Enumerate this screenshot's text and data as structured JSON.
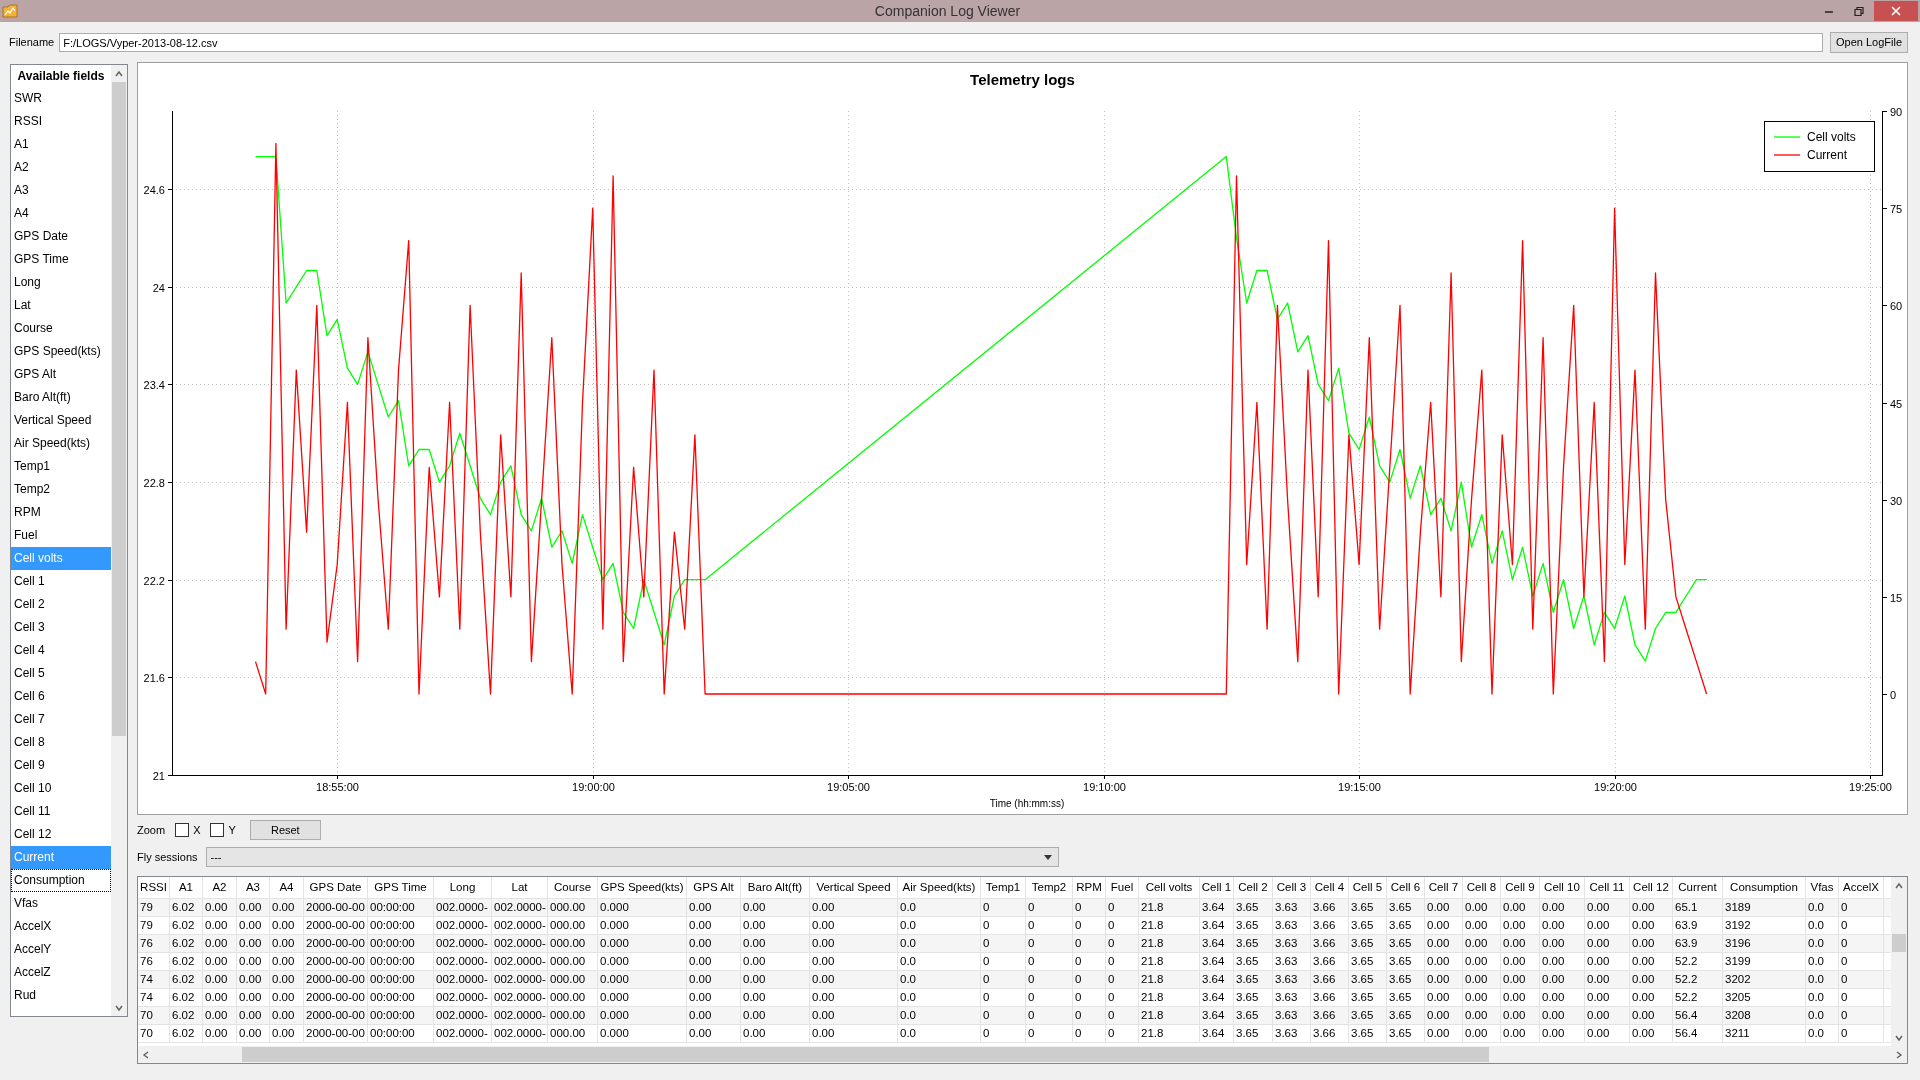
{
  "window": {
    "title": "Companion Log Viewer"
  },
  "filename": {
    "label": "Filename",
    "value": "F:/LOGS/Vyper-2013-08-12.csv",
    "button": "Open LogFile"
  },
  "fields": {
    "header": "Available fields",
    "items": [
      {
        "label": "SWR",
        "selected": false,
        "focused": false
      },
      {
        "label": "RSSI",
        "selected": false,
        "focused": false
      },
      {
        "label": "A1",
        "selected": false,
        "focused": false
      },
      {
        "label": "A2",
        "selected": false,
        "focused": false
      },
      {
        "label": "A3",
        "selected": false,
        "focused": false
      },
      {
        "label": "A4",
        "selected": false,
        "focused": false
      },
      {
        "label": "GPS Date",
        "selected": false,
        "focused": false
      },
      {
        "label": "GPS Time",
        "selected": false,
        "focused": false
      },
      {
        "label": "Long",
        "selected": false,
        "focused": false
      },
      {
        "label": "Lat",
        "selected": false,
        "focused": false
      },
      {
        "label": "Course",
        "selected": false,
        "focused": false
      },
      {
        "label": "GPS Speed(kts)",
        "selected": false,
        "focused": false
      },
      {
        "label": "GPS Alt",
        "selected": false,
        "focused": false
      },
      {
        "label": "Baro Alt(ft)",
        "selected": false,
        "focused": false
      },
      {
        "label": "Vertical Speed",
        "selected": false,
        "focused": false
      },
      {
        "label": "Air Speed(kts)",
        "selected": false,
        "focused": false
      },
      {
        "label": "Temp1",
        "selected": false,
        "focused": false
      },
      {
        "label": "Temp2",
        "selected": false,
        "focused": false
      },
      {
        "label": "RPM",
        "selected": false,
        "focused": false
      },
      {
        "label": "Fuel",
        "selected": false,
        "focused": false
      },
      {
        "label": "Cell volts",
        "selected": true,
        "focused": false
      },
      {
        "label": "Cell 1",
        "selected": false,
        "focused": false
      },
      {
        "label": "Cell 2",
        "selected": false,
        "focused": false
      },
      {
        "label": "Cell 3",
        "selected": false,
        "focused": false
      },
      {
        "label": "Cell 4",
        "selected": false,
        "focused": false
      },
      {
        "label": "Cell 5",
        "selected": false,
        "focused": false
      },
      {
        "label": "Cell 6",
        "selected": false,
        "focused": false
      },
      {
        "label": "Cell 7",
        "selected": false,
        "focused": false
      },
      {
        "label": "Cell 8",
        "selected": false,
        "focused": false
      },
      {
        "label": "Cell 9",
        "selected": false,
        "focused": false
      },
      {
        "label": "Cell 10",
        "selected": false,
        "focused": false
      },
      {
        "label": "Cell 11",
        "selected": false,
        "focused": false
      },
      {
        "label": "Cell 12",
        "selected": false,
        "focused": false
      },
      {
        "label": "Current",
        "selected": true,
        "focused": false
      },
      {
        "label": "Consumption",
        "selected": false,
        "focused": true
      },
      {
        "label": "Vfas",
        "selected": false,
        "focused": false
      },
      {
        "label": "AccelX",
        "selected": false,
        "focused": false
      },
      {
        "label": "AccelY",
        "selected": false,
        "focused": false
      },
      {
        "label": "AccelZ",
        "selected": false,
        "focused": false
      },
      {
        "label": "Rud",
        "selected": false,
        "focused": false
      }
    ]
  },
  "chart": {
    "chart_data": {
      "type": "line",
      "title": "Telemetry logs",
      "xlabel": "Time (hh:mm:ss)",
      "x": [
        68004,
        68016,
        68028,
        68040,
        68052,
        68064,
        68076,
        68088,
        68100,
        68112,
        68124,
        68136,
        68148,
        68160,
        68172,
        68184,
        68196,
        68208,
        68220,
        68232,
        68244,
        68256,
        68268,
        68280,
        68292,
        68304,
        68316,
        68328,
        68340,
        68352,
        68364,
        68376,
        68388,
        68400,
        68412,
        68424,
        68436,
        68448,
        68460,
        68472,
        68484,
        68496,
        68508,
        68520,
        68532,
        69144,
        69156,
        69168,
        69180,
        69192,
        69204,
        69216,
        69228,
        69240,
        69252,
        69264,
        69276,
        69288,
        69300,
        69312,
        69324,
        69336,
        69348,
        69360,
        69372,
        69384,
        69396,
        69408,
        69420,
        69432,
        69444,
        69456,
        69468,
        69480,
        69492,
        69504,
        69516,
        69528,
        69540,
        69552,
        69564,
        69576,
        69588,
        69600,
        69612,
        69624,
        69636,
        69648,
        69660,
        69672,
        69684,
        69696,
        69708
      ],
      "xlim": [
        67906,
        69914
      ],
      "grid": true,
      "legend": "upper right",
      "xticks": [
        {
          "value": 68100,
          "label": "18:55:00"
        },
        {
          "value": 68400,
          "label": "19:00:00"
        },
        {
          "value": 68700,
          "label": "19:05:00"
        },
        {
          "value": 69000,
          "label": "19:10:00"
        },
        {
          "value": 69300,
          "label": "19:15:00"
        },
        {
          "value": 69600,
          "label": "19:20:00"
        },
        {
          "value": 69900,
          "label": "19:25:00"
        }
      ],
      "ylim": [
        21,
        25.08
      ],
      "yticks": [
        21,
        21.6,
        22.2,
        22.8,
        23.4,
        24,
        24.6
      ],
      "y2lim": [
        -12.5,
        90
      ],
      "y2ticks": [
        0,
        15,
        30,
        45,
        60,
        75,
        90
      ],
      "series": [
        {
          "name": "Cell volts",
          "color": "#00ff00",
          "values": [
            24.8,
            24.8,
            24.8,
            23.9,
            24.0,
            24.1,
            24.1,
            23.7,
            23.8,
            23.5,
            23.4,
            23.6,
            23.4,
            23.2,
            23.3,
            22.9,
            23.0,
            23.0,
            22.8,
            22.9,
            23.1,
            22.9,
            22.7,
            22.6,
            22.8,
            22.9,
            22.6,
            22.5,
            22.7,
            22.4,
            22.5,
            22.3,
            22.6,
            22.4,
            22.2,
            22.3,
            22.0,
            21.9,
            22.2,
            22.0,
            21.8,
            22.1,
            22.2,
            22.2,
            22.2,
            24.8,
            24.3,
            23.9,
            24.1,
            24.1,
            23.8,
            23.9,
            23.6,
            23.7,
            23.4,
            23.3,
            23.5,
            23.1,
            23.0,
            23.2,
            22.9,
            22.8,
            23.0,
            22.7,
            22.9,
            22.6,
            22.7,
            22.5,
            22.8,
            22.4,
            22.6,
            22.3,
            22.5,
            22.2,
            22.4,
            22.1,
            22.3,
            22.0,
            22.2,
            21.9,
            22.1,
            21.8,
            22.0,
            21.9,
            22.1,
            21.8,
            21.7,
            21.9,
            22.0,
            22.0,
            22.1,
            22.2,
            22.2
          ]
        },
        {
          "name": "Current",
          "color": "#ff0000",
          "axis": "y2",
          "values": [
            5,
            0,
            85,
            10,
            50,
            25,
            60,
            8,
            20,
            45,
            5,
            55,
            30,
            10,
            50,
            70,
            0,
            35,
            15,
            45,
            10,
            60,
            25,
            0,
            40,
            15,
            65,
            5,
            30,
            55,
            20,
            0,
            45,
            75,
            10,
            80,
            5,
            35,
            15,
            50,
            0,
            25,
            10,
            40,
            0,
            0,
            80,
            20,
            45,
            10,
            60,
            30,
            5,
            50,
            15,
            70,
            0,
            40,
            20,
            55,
            10,
            35,
            60,
            0,
            25,
            45,
            15,
            65,
            5,
            30,
            50,
            0,
            40,
            20,
            70,
            10,
            55,
            0,
            35,
            60,
            15,
            45,
            5,
            75,
            20,
            50,
            10,
            65,
            30,
            15,
            10,
            5,
            0
          ]
        }
      ]
    }
  },
  "zoom": {
    "label": "Zoom",
    "options": [
      {
        "label": "X",
        "checked": false
      },
      {
        "label": "Y",
        "checked": false
      }
    ],
    "reset_button": "Reset"
  },
  "fly_sessions": {
    "label": "Fly sessions",
    "value": "---"
  },
  "table": {
    "columns": [
      "RSSI",
      "A1",
      "A2",
      "A3",
      "A4",
      "GPS Date",
      "GPS Time",
      "Long",
      "Lat",
      "Course",
      "GPS Speed(kts)",
      "GPS Alt",
      "Baro Alt(ft)",
      "Vertical Speed",
      "Air Speed(kts)",
      "Temp1",
      "Temp2",
      "RPM",
      "Fuel",
      "Cell volts",
      "Cell 1",
      "Cell 2",
      "Cell 3",
      "Cell 4",
      "Cell 5",
      "Cell 6",
      "Cell 7",
      "Cell 8",
      "Cell 9",
      "Cell 10",
      "Cell 11",
      "Cell 12",
      "Current",
      "Consumption",
      "Vfas",
      "AccelX"
    ],
    "rows": [
      [
        "79",
        "6.02",
        "0.00",
        "0.00",
        "0.00",
        "2000-00-00",
        "00:00:00",
        "002.0000-",
        "002.0000-",
        "000.00",
        "0.000",
        "0.00",
        "0.00",
        "0.00",
        "0.0",
        "0",
        "0",
        "0",
        "0",
        "21.8",
        "3.64",
        "3.65",
        "3.63",
        "3.66",
        "3.65",
        "3.65",
        "0.00",
        "0.00",
        "0.00",
        "0.00",
        "0.00",
        "0.00",
        "65.1",
        "3189",
        "0.0",
        "0"
      ],
      [
        "79",
        "6.02",
        "0.00",
        "0.00",
        "0.00",
        "2000-00-00",
        "00:00:00",
        "002.0000-",
        "002.0000-",
        "000.00",
        "0.000",
        "0.00",
        "0.00",
        "0.00",
        "0.0",
        "0",
        "0",
        "0",
        "0",
        "21.8",
        "3.64",
        "3.65",
        "3.63",
        "3.66",
        "3.65",
        "3.65",
        "0.00",
        "0.00",
        "0.00",
        "0.00",
        "0.00",
        "0.00",
        "63.9",
        "3192",
        "0.0",
        "0"
      ],
      [
        "76",
        "6.02",
        "0.00",
        "0.00",
        "0.00",
        "2000-00-00",
        "00:00:00",
        "002.0000-",
        "002.0000-",
        "000.00",
        "0.000",
        "0.00",
        "0.00",
        "0.00",
        "0.0",
        "0",
        "0",
        "0",
        "0",
        "21.8",
        "3.64",
        "3.65",
        "3.63",
        "3.66",
        "3.65",
        "3.65",
        "0.00",
        "0.00",
        "0.00",
        "0.00",
        "0.00",
        "0.00",
        "63.9",
        "3196",
        "0.0",
        "0"
      ],
      [
        "76",
        "6.02",
        "0.00",
        "0.00",
        "0.00",
        "2000-00-00",
        "00:00:00",
        "002.0000-",
        "002.0000-",
        "000.00",
        "0.000",
        "0.00",
        "0.00",
        "0.00",
        "0.0",
        "0",
        "0",
        "0",
        "0",
        "21.8",
        "3.64",
        "3.65",
        "3.63",
        "3.66",
        "3.65",
        "3.65",
        "0.00",
        "0.00",
        "0.00",
        "0.00",
        "0.00",
        "0.00",
        "52.2",
        "3199",
        "0.0",
        "0"
      ],
      [
        "74",
        "6.02",
        "0.00",
        "0.00",
        "0.00",
        "2000-00-00",
        "00:00:00",
        "002.0000-",
        "002.0000-",
        "000.00",
        "0.000",
        "0.00",
        "0.00",
        "0.00",
        "0.0",
        "0",
        "0",
        "0",
        "0",
        "21.8",
        "3.64",
        "3.65",
        "3.63",
        "3.66",
        "3.65",
        "3.65",
        "0.00",
        "0.00",
        "0.00",
        "0.00",
        "0.00",
        "0.00",
        "52.2",
        "3202",
        "0.0",
        "0"
      ],
      [
        "74",
        "6.02",
        "0.00",
        "0.00",
        "0.00",
        "2000-00-00",
        "00:00:00",
        "002.0000-",
        "002.0000-",
        "000.00",
        "0.000",
        "0.00",
        "0.00",
        "0.00",
        "0.0",
        "0",
        "0",
        "0",
        "0",
        "21.8",
        "3.64",
        "3.65",
        "3.63",
        "3.66",
        "3.65",
        "3.65",
        "0.00",
        "0.00",
        "0.00",
        "0.00",
        "0.00",
        "0.00",
        "52.2",
        "3205",
        "0.0",
        "0"
      ],
      [
        "70",
        "6.02",
        "0.00",
        "0.00",
        "0.00",
        "2000-00-00",
        "00:00:00",
        "002.0000-",
        "002.0000-",
        "000.00",
        "0.000",
        "0.00",
        "0.00",
        "0.00",
        "0.0",
        "0",
        "0",
        "0",
        "0",
        "21.8",
        "3.64",
        "3.65",
        "3.63",
        "3.66",
        "3.65",
        "3.65",
        "0.00",
        "0.00",
        "0.00",
        "0.00",
        "0.00",
        "0.00",
        "56.4",
        "3208",
        "0.0",
        "0"
      ],
      [
        "70",
        "6.02",
        "0.00",
        "0.00",
        "0.00",
        "2000-00-00",
        "00:00:00",
        "002.0000-",
        "002.0000-",
        "000.00",
        "0.000",
        "0.00",
        "0.00",
        "0.00",
        "0.0",
        "0",
        "0",
        "0",
        "0",
        "21.8",
        "3.64",
        "3.65",
        "3.63",
        "3.66",
        "3.65",
        "3.65",
        "0.00",
        "0.00",
        "0.00",
        "0.00",
        "0.00",
        "0.00",
        "56.4",
        "3211",
        "0.0",
        "0"
      ]
    ]
  }
}
